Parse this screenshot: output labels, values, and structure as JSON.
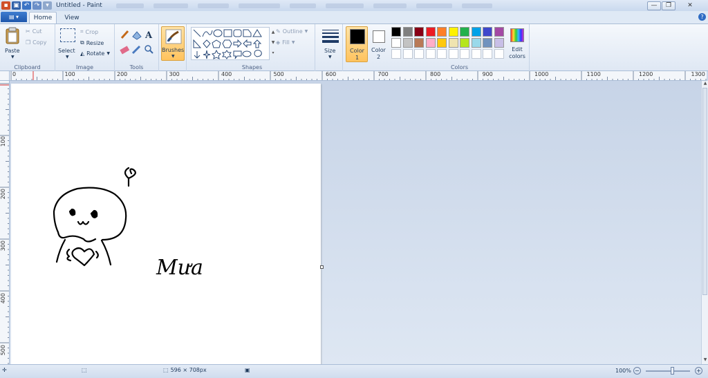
{
  "window": {
    "title": "Untitled - Paint"
  },
  "window_controls": {
    "minimize": "—",
    "maximize": "❐",
    "close": "✕"
  },
  "app_menu": {
    "label": "▤ ▾"
  },
  "tabs": [
    {
      "label": "Home"
    },
    {
      "label": "View"
    }
  ],
  "help": "?",
  "clipboard": {
    "label": "Clipboard",
    "paste": "Paste",
    "cut": "Cut",
    "copy": "Copy"
  },
  "image": {
    "label": "Image",
    "select": "Select",
    "crop": "Crop",
    "resize": "Resize",
    "rotate": "Rotate"
  },
  "tools": {
    "label": "Tools"
  },
  "brushes": {
    "label": "Brushes"
  },
  "shapes": {
    "label": "Shapes",
    "outline": "Outline",
    "fill": "Fill"
  },
  "size": {
    "label": "Size"
  },
  "color1": {
    "label": "Color",
    "num": "1",
    "value": "#000000"
  },
  "color2": {
    "label": "Color",
    "num": "2",
    "value": "#ffffff"
  },
  "colors": {
    "label": "Colors",
    "edit": "Edit colors",
    "row1": [
      "#000000",
      "#7f7f7f",
      "#880015",
      "#ed1c24",
      "#ff7f27",
      "#fff200",
      "#22b14c",
      "#00a2e8",
      "#3f48cc",
      "#a349a4"
    ],
    "row2": [
      "#ffffff",
      "#c3c3c3",
      "#b97a57",
      "#ffaec9",
      "#ffc90e",
      "#efe4b0",
      "#b5e61d",
      "#99d9ea",
      "#7092be",
      "#c8bfe7"
    ]
  },
  "ruler": {
    "h": [
      "0",
      "100",
      "200",
      "300",
      "400",
      "500",
      "600",
      "700",
      "800",
      "900",
      "1000",
      "1100",
      "1200",
      "1300"
    ],
    "v": [
      "100",
      "200",
      "300",
      "400",
      "500"
    ]
  },
  "drawing": {
    "text": "Mưa"
  },
  "status": {
    "size": "596 × 708px",
    "zoom": "100%"
  }
}
